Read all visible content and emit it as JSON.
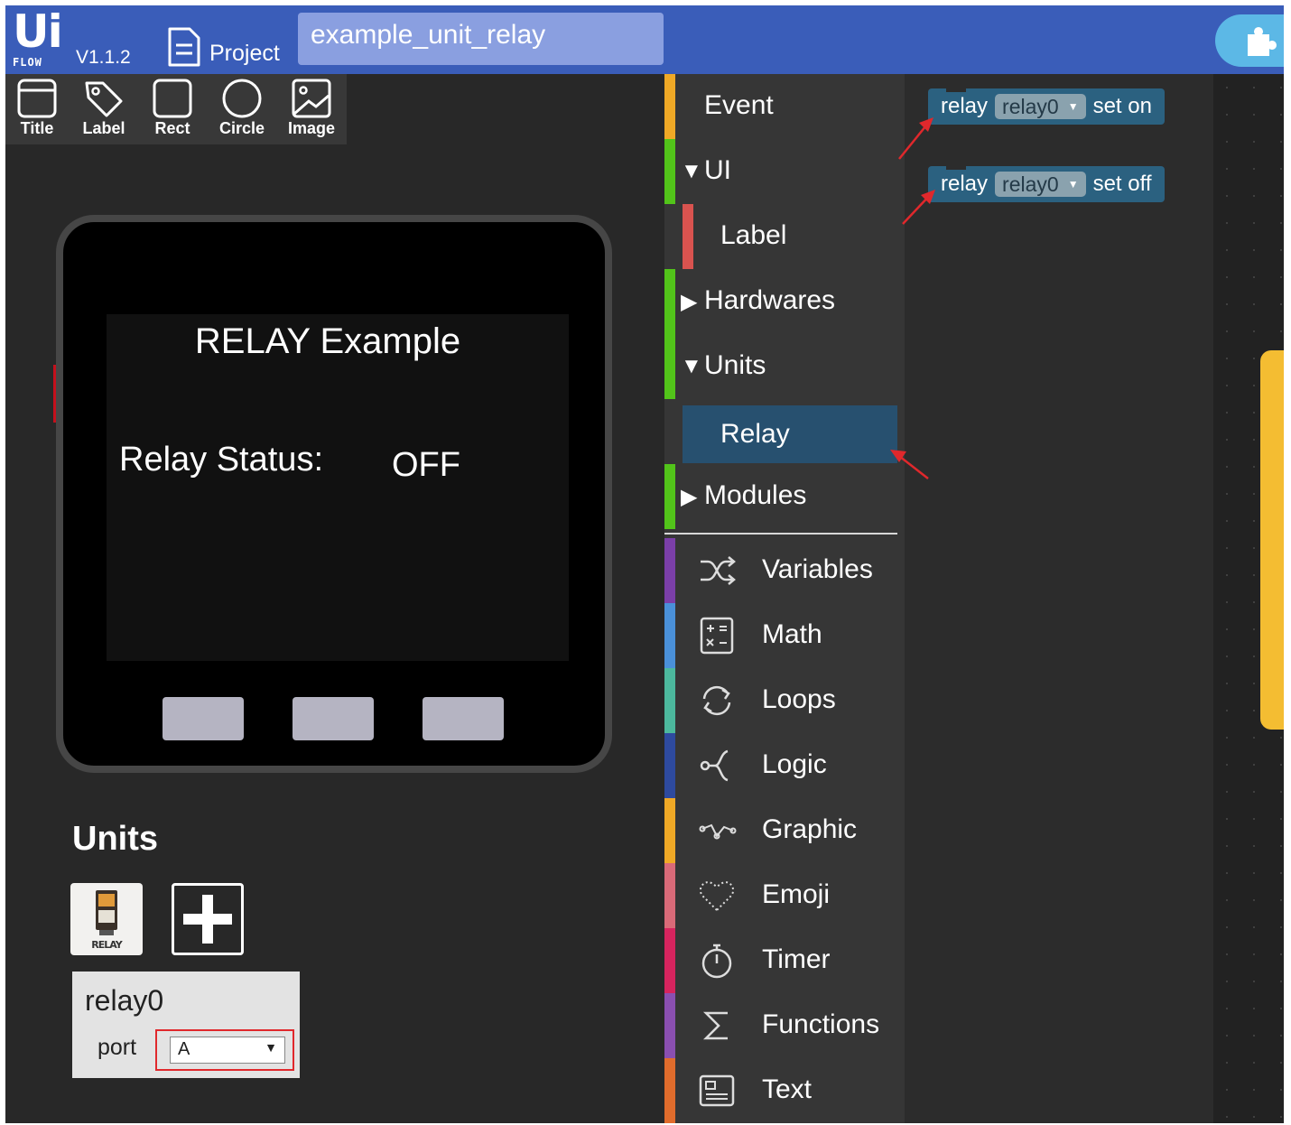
{
  "header": {
    "logo_main": "Ui",
    "logo_sub": "FLOW",
    "version": "V1.1.2",
    "project_label": "Project",
    "project_name": "example_unit_relay"
  },
  "palette": {
    "items": [
      {
        "label": "Title",
        "icon": "title-icon"
      },
      {
        "label": "Label",
        "icon": "label-icon"
      },
      {
        "label": "Rect",
        "icon": "rect-icon"
      },
      {
        "label": "Circle",
        "icon": "circle-icon"
      },
      {
        "label": "Image",
        "icon": "image-icon"
      }
    ]
  },
  "device": {
    "screen_title": "RELAY Example",
    "status_label": "Relay Status:",
    "status_value": "OFF"
  },
  "units": {
    "title": "Units",
    "relay_icon_text": "RELAY",
    "card": {
      "name": "relay0",
      "port_label": "port",
      "port_value": "A",
      "port_arrow": "▼"
    }
  },
  "toolbox": {
    "event": "Event",
    "ui": "UI",
    "label": "Label",
    "hardwares": "Hardwares",
    "units": "Units",
    "relay": "Relay",
    "modules": "Modules",
    "variables": "Variables",
    "math": "Math",
    "loops": "Loops",
    "logic": "Logic",
    "graphic": "Graphic",
    "emoji": "Emoji",
    "timer": "Timer",
    "functions": "Functions",
    "text": "Text",
    "expanded_arrow": "▼",
    "collapsed_arrow": "▶",
    "colors": {
      "event": "#f0a926",
      "ui": "#52c41a",
      "label": "#d9534f",
      "hardwares": "#52c41a",
      "units": "#52c41a",
      "modules": "#52c41a",
      "variables": "#7b3fa8",
      "math": "#4a90d9",
      "loops": "#4cb89d",
      "logic": "#2e4a9e",
      "graphic": "#f0a926",
      "emoji": "#d96a78",
      "timer": "#d6245e",
      "functions": "#8a4fb0",
      "text": "#e06c2c"
    }
  },
  "workspace": {
    "block_on": {
      "keyword": "relay",
      "dropdown": "relay0",
      "dropdown_arrow": "▼",
      "action": "set on"
    },
    "block_off": {
      "keyword": "relay",
      "dropdown": "relay0",
      "dropdown_arrow": "▼",
      "action": "set off"
    },
    "block_color": "#2b6180",
    "annotation_color": "#e0282c"
  }
}
